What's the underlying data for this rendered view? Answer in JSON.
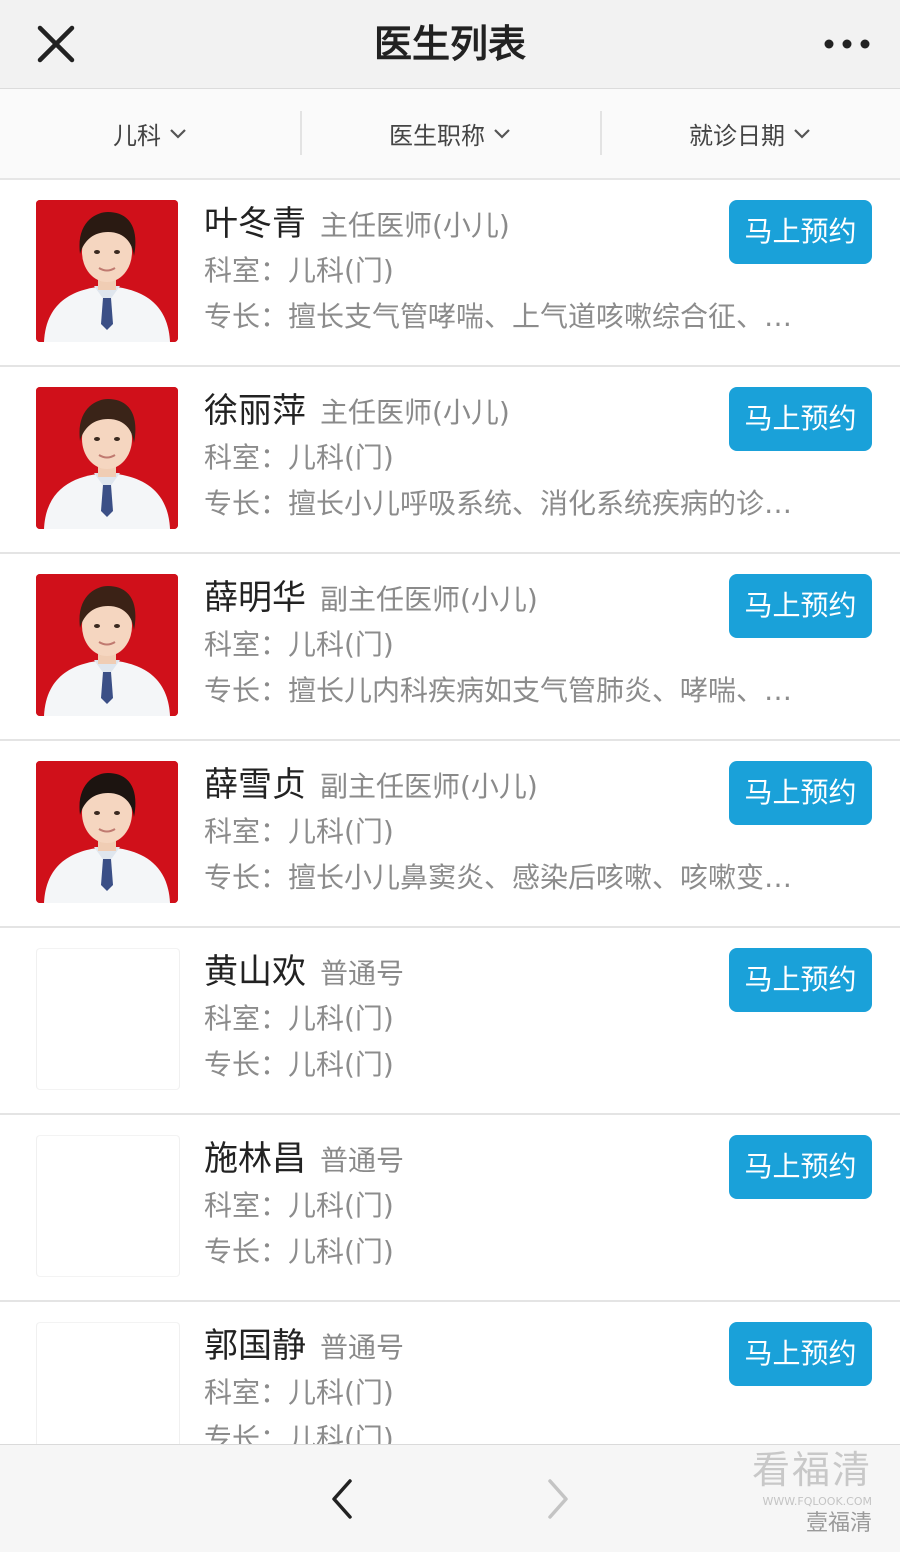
{
  "header": {
    "title": "医生列表"
  },
  "filters": [
    {
      "label": "儿科"
    },
    {
      "label": "医生职称"
    },
    {
      "label": "就诊日期"
    }
  ],
  "book_label": "马上预约",
  "doctors": [
    {
      "name": "叶冬青",
      "title": "主任医师(小儿)",
      "dept": "科室：儿科(门)",
      "specialty": "专长：擅长支气管哮喘、上气道咳嗽综合征、…",
      "avatar": "photo",
      "hair": "#2a1a12"
    },
    {
      "name": "徐丽萍",
      "title": "主任医师(小儿)",
      "dept": "科室：儿科(门)",
      "specialty": "专长：擅长小儿呼吸系统、消化系统疾病的诊…",
      "avatar": "photo",
      "hair": "#3a2418"
    },
    {
      "name": "薛明华",
      "title": "副主任医师(小儿)",
      "dept": "科室：儿科(门)",
      "specialty": "专长：擅长儿内科疾病如支气管肺炎、哮喘、…",
      "avatar": "photo",
      "hair": "#3b2216"
    },
    {
      "name": "薛雪贞",
      "title": "副主任医师(小儿)",
      "dept": "科室：儿科(门)",
      "specialty": "专长：擅长小儿鼻窦炎、感染后咳嗽、咳嗽变…",
      "avatar": "photo",
      "hair": "#1c1410"
    },
    {
      "name": "黄山欢",
      "title": "普通号",
      "dept": "科室：儿科(门)",
      "specialty": "专长：儿科(门)",
      "avatar": "blank"
    },
    {
      "name": "施林昌",
      "title": "普通号",
      "dept": "科室：儿科(门)",
      "specialty": "专长：儿科(门)",
      "avatar": "blank"
    },
    {
      "name": "郭国静",
      "title": "普通号",
      "dept": "科室：儿科(门)",
      "specialty": "专长：儿科(门)",
      "avatar": "blank"
    }
  ],
  "watermark": {
    "brand": "看福清",
    "url": "WWW.FQLOOK.COM",
    "account": "壹福清"
  },
  "colors": {
    "accent": "#1aa1d9",
    "photo_bg": "#d0101a"
  }
}
